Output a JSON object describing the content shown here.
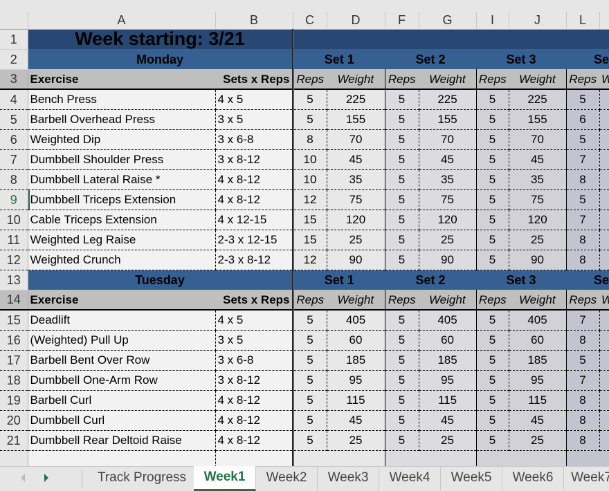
{
  "columns": [
    "A",
    "B",
    "C",
    "D",
    "F",
    "G",
    "I",
    "J",
    "L",
    ""
  ],
  "title": "Week starting:  3/21",
  "set_labels": [
    "Set 1",
    "Set 2",
    "Set 3",
    "Se"
  ],
  "header": {
    "exercise": "Exercise",
    "sets_reps": "Sets x Reps",
    "reps": "Reps",
    "weight": "Weight"
  },
  "colors": {
    "title_bg": "#284873",
    "day_bg": "#366092",
    "header_bg": "#bfbfbf",
    "accent": "#217346"
  },
  "days": [
    {
      "name": "Monday",
      "day_row": 2,
      "header_row": 3,
      "rows": [
        {
          "n": 4,
          "exercise": "Bench Press",
          "sets": "4 x 5",
          "vals": [
            "5",
            "225",
            "5",
            "225",
            "5",
            "225",
            "5"
          ]
        },
        {
          "n": 5,
          "exercise": "Barbell Overhead Press",
          "sets": "3 x 5",
          "vals": [
            "5",
            "155",
            "5",
            "155",
            "5",
            "155",
            "6"
          ]
        },
        {
          "n": 6,
          "exercise": "Weighted Dip",
          "sets": "3 x 6-8",
          "vals": [
            "8",
            "70",
            "5",
            "70",
            "5",
            "70",
            "5"
          ]
        },
        {
          "n": 7,
          "exercise": "Dumbbell Shoulder Press",
          "sets": "3 x 8-12",
          "vals": [
            "10",
            "45",
            "5",
            "45",
            "5",
            "45",
            "7"
          ]
        },
        {
          "n": 8,
          "exercise": "Dumbbell Lateral Raise *",
          "sets": "4 x 8-12",
          "vals": [
            "10",
            "35",
            "5",
            "35",
            "5",
            "35",
            "8"
          ]
        },
        {
          "n": 9,
          "exercise": "Dumbbell Triceps Extension",
          "sets": "4 x 8-12",
          "vals": [
            "12",
            "75",
            "5",
            "75",
            "5",
            "75",
            "5"
          ]
        },
        {
          "n": 10,
          "exercise": "Cable Triceps Extension",
          "sets": "4 x 12-15",
          "vals": [
            "15",
            "120",
            "5",
            "120",
            "5",
            "120",
            "7"
          ]
        },
        {
          "n": 11,
          "exercise": "Weighted Leg Raise",
          "sets": "2-3 x 12-15",
          "vals": [
            "15",
            "25",
            "5",
            "25",
            "5",
            "25",
            "8"
          ]
        },
        {
          "n": 12,
          "exercise": "Weighted Crunch",
          "sets": "2-3 x 8-12",
          "vals": [
            "12",
            "90",
            "5",
            "90",
            "5",
            "90",
            "8"
          ]
        }
      ]
    },
    {
      "name": "Tuesday",
      "day_row": 13,
      "header_row": 14,
      "rows": [
        {
          "n": 15,
          "exercise": "Deadlift",
          "sets": "4 x 5",
          "vals": [
            "5",
            "405",
            "5",
            "405",
            "5",
            "405",
            "7"
          ]
        },
        {
          "n": 16,
          "exercise": "(Weighted) Pull Up",
          "sets": "3 x 5",
          "vals": [
            "5",
            "60",
            "5",
            "60",
            "5",
            "60",
            "8"
          ]
        },
        {
          "n": 17,
          "exercise": "Barbell Bent Over Row",
          "sets": "3 x 6-8",
          "vals": [
            "5",
            "185",
            "5",
            "185",
            "5",
            "185",
            "5"
          ]
        },
        {
          "n": 18,
          "exercise": "Dumbbell One-Arm Row",
          "sets": "3 x 8-12",
          "vals": [
            "5",
            "95",
            "5",
            "95",
            "5",
            "95",
            "7"
          ]
        },
        {
          "n": 19,
          "exercise": "Barbell Curl",
          "sets": "4 x 8-12",
          "vals": [
            "5",
            "115",
            "5",
            "115",
            "5",
            "115",
            "8"
          ]
        },
        {
          "n": 20,
          "exercise": "Dumbbell Curl",
          "sets": "4 x 8-12",
          "vals": [
            "5",
            "45",
            "5",
            "45",
            "5",
            "45",
            "8"
          ]
        },
        {
          "n": 21,
          "exercise": "Dumbbell Rear Deltoid Raise",
          "sets": "4 x 8-12",
          "vals": [
            "5",
            "25",
            "5",
            "25",
            "5",
            "25",
            "8"
          ]
        }
      ]
    }
  ],
  "selected_row": 9,
  "sheet_tabs": [
    "Track Progress",
    "Week1",
    "Week2",
    "Week3",
    "Week4",
    "Week5",
    "Week6",
    "Week7"
  ],
  "active_tab": "Week1"
}
